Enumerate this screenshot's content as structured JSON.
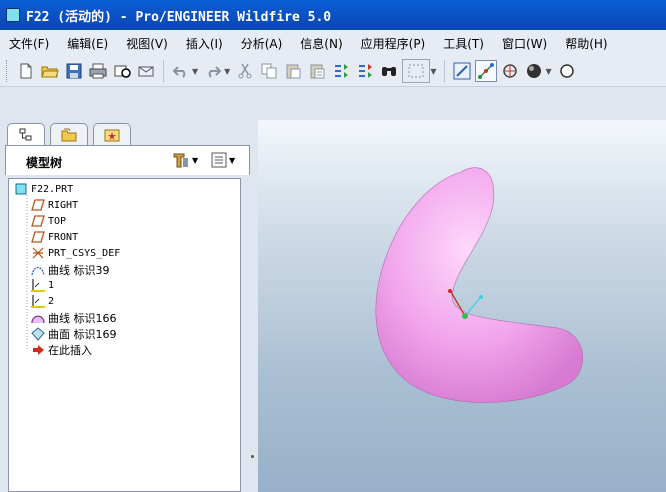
{
  "window": {
    "title": "F22 (活动的) - Pro/ENGINEER Wildfire 5.0"
  },
  "menubar": {
    "items": [
      {
        "label": "文件(F)"
      },
      {
        "label": "编辑(E)"
      },
      {
        "label": "视图(V)"
      },
      {
        "label": "插入(I)"
      },
      {
        "label": "分析(A)"
      },
      {
        "label": "信息(N)"
      },
      {
        "label": "应用程序(P)"
      },
      {
        "label": "工具(T)"
      },
      {
        "label": "窗口(W)"
      },
      {
        "label": "帮助(H)"
      }
    ]
  },
  "toolbar": {
    "icons": [
      "new-file-icon",
      "open-folder-icon",
      "save-icon",
      "print-icon",
      "erase-icon",
      "mail-icon",
      "undo-icon",
      "redo-icon",
      "cut-icon",
      "copy-icon",
      "paste-icon",
      "paste-special-icon",
      "regenerate-icon",
      "regenerate-manager-icon",
      "find-icon",
      "select-box-icon",
      "repaint-icon",
      "spin-center-icon",
      "orient-icon",
      "shade-icon",
      "zoom-icon"
    ]
  },
  "model_tree": {
    "title": "模型树",
    "items": [
      {
        "label": "F22.PRT",
        "icon": "part-icon",
        "level": 0
      },
      {
        "label": "RIGHT",
        "icon": "datum-plane-icon",
        "level": 1
      },
      {
        "label": "TOP",
        "icon": "datum-plane-icon",
        "level": 1
      },
      {
        "label": "FRONT",
        "icon": "datum-plane-icon",
        "level": 1
      },
      {
        "label": "PRT_CSYS_DEF",
        "icon": "csys-icon",
        "level": 1
      },
      {
        "label": "曲线 标识39",
        "icon": "curve-icon",
        "level": 1
      },
      {
        "label": "1",
        "icon": "sketch-icon",
        "level": 1
      },
      {
        "label": "2",
        "icon": "sketch-icon",
        "level": 1
      },
      {
        "label": "曲线 标识166",
        "icon": "curve-icon",
        "level": 1
      },
      {
        "label": "曲面 标识169",
        "icon": "surface-icon",
        "level": 1
      },
      {
        "label": "在此插入",
        "icon": "insert-here-icon",
        "level": 1
      }
    ]
  },
  "colors": {
    "title_bar": "#0b4fc0",
    "model_surface": "#f2a6ec",
    "viewport_bg": "#b6c7d9"
  }
}
